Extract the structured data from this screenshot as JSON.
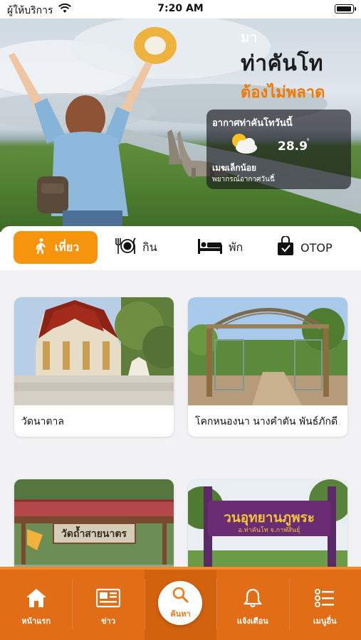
{
  "status_bar": {
    "carrier": "ผู้ให้บริการ",
    "time": "7:20 AM"
  },
  "hero": {
    "line1": "มา",
    "line2": "ท่าคันโท",
    "line3": "ต้องไม่พลาด",
    "weather": {
      "title": "อากาศท่าคันโทวันนี้",
      "temperature": "28.9",
      "unit": "°",
      "description": "เมฆเล็กน้อย",
      "forecast_link": "พยากรณ์อากาศวันนี้",
      "icon": "partly-cloudy-icon"
    }
  },
  "tabs": [
    {
      "label": "เที่ยว",
      "icon": "walking-icon",
      "active": true
    },
    {
      "label": "กิน",
      "icon": "plate-cutlery-icon",
      "active": false
    },
    {
      "label": "พัก",
      "icon": "bed-icon",
      "active": false
    },
    {
      "label": "OTOP",
      "icon": "shopping-bag-icon",
      "active": false
    }
  ],
  "cards": [
    {
      "title": "วัดนาตาล"
    },
    {
      "title": "โคกหนองนา นางคำตัน พันธ์ภักดี"
    },
    {
      "title": "",
      "sign_text": "วัดถ้ำสายนาตร"
    },
    {
      "title": "",
      "sign_text": "วนอุทยานภูพระ",
      "sign_sub": "อ.ท่าคันโท จ.กาฬสินธุ์"
    }
  ],
  "bottom_nav": [
    {
      "label": "หน้าแรก",
      "icon": "home-icon"
    },
    {
      "label": "ข่าว",
      "icon": "newspaper-icon"
    },
    {
      "label": "ค้นหา",
      "icon": "search-icon"
    },
    {
      "label": "แจ้งเตือน",
      "icon": "bell-icon"
    },
    {
      "label": "เมนูอื่น",
      "icon": "menu-list-icon"
    }
  ],
  "colors": {
    "accent": "#f7940d",
    "nav_bg": "#e16e16",
    "hero_orange_text": "#f27a00"
  }
}
